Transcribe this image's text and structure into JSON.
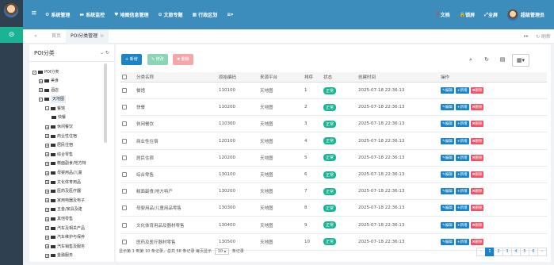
{
  "topbar": {
    "menu": [
      {
        "label": "系统管理",
        "icon": "gear-icon",
        "glyph": "⚙"
      },
      {
        "label": "系统监控",
        "icon": "monitor-icon",
        "glyph": "▬"
      },
      {
        "label": "地图信息管理",
        "icon": "map-pin-icon",
        "glyph": "♥"
      },
      {
        "label": "文旅专题",
        "icon": "globe-icon",
        "glyph": "⊙"
      },
      {
        "label": "行政区划",
        "icon": "building-icon",
        "glyph": "▦"
      },
      {
        "label": "",
        "icon": "more-menu-icon",
        "glyph": "≡▾"
      }
    ],
    "right": [
      {
        "label": "文档",
        "icon": "question-icon",
        "glyph": "❓"
      },
      {
        "label": "锁屏",
        "icon": "lock-icon",
        "glyph": "🔒"
      },
      {
        "label": "全屏",
        "icon": "fullscreen-icon",
        "glyph": "⤢"
      }
    ],
    "user": "超级管理员"
  },
  "tabs": {
    "home": "首页",
    "current": "POI分类管理"
  },
  "tree": {
    "title": "POI分类",
    "root": "POI分类",
    "nodes": [
      {
        "label": "美食",
        "level": 1,
        "expander": "+"
      },
      {
        "label": "酒店",
        "level": 1,
        "expander": "+"
      },
      {
        "label": "天地图",
        "level": 1,
        "expander": "-",
        "selected": true
      },
      {
        "label": "餐馆",
        "level": 2,
        "expander": "-"
      },
      {
        "label": "快餐",
        "level": 3,
        "expander": ""
      },
      {
        "label": "休闲餐饮",
        "level": 2,
        "expander": "+"
      },
      {
        "label": "商业性住宿",
        "level": 2,
        "expander": "+"
      },
      {
        "label": "居民住宿",
        "level": 2,
        "expander": "+"
      },
      {
        "label": "综合零售",
        "level": 2,
        "expander": "+"
      },
      {
        "label": "糕面副食/地方特",
        "level": 2,
        "expander": "+"
      },
      {
        "label": "母婴用品/儿童",
        "level": 2,
        "expander": "+"
      },
      {
        "label": "文化体育用品",
        "level": 2,
        "expander": "+"
      },
      {
        "label": "医药及医疗器",
        "level": 2,
        "expander": "+"
      },
      {
        "label": "家用电器及电子",
        "level": 2,
        "expander": "+"
      },
      {
        "label": "五金/家具及建",
        "level": 2,
        "expander": "+"
      },
      {
        "label": "其他零售",
        "level": 2,
        "expander": "+"
      },
      {
        "label": "汽车及相关产品",
        "level": 2,
        "expander": "+"
      },
      {
        "label": "汽车维护与保养",
        "level": 2,
        "expander": "+"
      },
      {
        "label": "汽车销售及服务",
        "level": 2,
        "expander": "+"
      },
      {
        "label": "金融服务",
        "level": 2,
        "expander": "+"
      }
    ]
  },
  "toolbar": {
    "add": "新增",
    "edit": "修改",
    "delete": "删除"
  },
  "table": {
    "columns": [
      "分类名称",
      "原始编码",
      "来源平台",
      "排序",
      "状态",
      "创建时间",
      "操作"
    ],
    "rows": [
      {
        "name": "餐馆",
        "code": "110100",
        "platform": "天地图",
        "sort": "1",
        "status": "正常",
        "created": "2025-07-18 22:36:13"
      },
      {
        "name": "快餐",
        "code": "110200",
        "platform": "天地图",
        "sort": "2",
        "status": "正常",
        "created": "2025-07-18 22:36:13"
      },
      {
        "name": "休闲餐饮",
        "code": "110300",
        "platform": "天地图",
        "sort": "3",
        "status": "正常",
        "created": "2025-07-18 22:36:13"
      },
      {
        "name": "商业性住宿",
        "code": "120100",
        "platform": "天地图",
        "sort": "4",
        "status": "正常",
        "created": "2025-07-18 22:36:13"
      },
      {
        "name": "居民住宿",
        "code": "120200",
        "platform": "天地图",
        "sort": "5",
        "status": "正常",
        "created": "2025-07-18 22:36:13"
      },
      {
        "name": "综合零售",
        "code": "130100",
        "platform": "天地图",
        "sort": "6",
        "status": "正常",
        "created": "2025-07-18 22:36:13"
      },
      {
        "name": "糕面副食/地方特产",
        "code": "130200",
        "platform": "天地图",
        "sort": "7",
        "status": "正常",
        "created": "2025-07-18 22:36:13"
      },
      {
        "name": "母婴用品/儿童用品零售",
        "code": "130300",
        "platform": "天地图",
        "sort": "8",
        "status": "正常",
        "created": "2025-07-18 22:36:13"
      },
      {
        "name": "文化体育用品及器材零售",
        "code": "130400",
        "platform": "天地图",
        "sort": "9",
        "status": "正常",
        "created": "2025-07-18 22:36:13"
      },
      {
        "name": "医药及医疗器材零售",
        "code": "130500",
        "platform": "天地图",
        "sort": "10",
        "status": "正常",
        "created": "2025-07-18 22:36:13"
      }
    ],
    "actions": {
      "edit": "编辑",
      "add": "新增",
      "delete": "删除"
    }
  },
  "footer": {
    "summary": "显示第 1 到第 10 条记录，总共 58 条记录 每页显示",
    "page_size": "10 ▴",
    "suffix": "条记录",
    "pages": [
      "‹",
      "1",
      "2",
      "3",
      "4",
      "5",
      "6",
      "›"
    ],
    "active_page": "1"
  },
  "colors": {
    "topbar": "#3c8dbc",
    "rail": "#2f4050",
    "accent": "#1ab394",
    "primary": "#1c84c6",
    "danger": "#ed5565"
  }
}
